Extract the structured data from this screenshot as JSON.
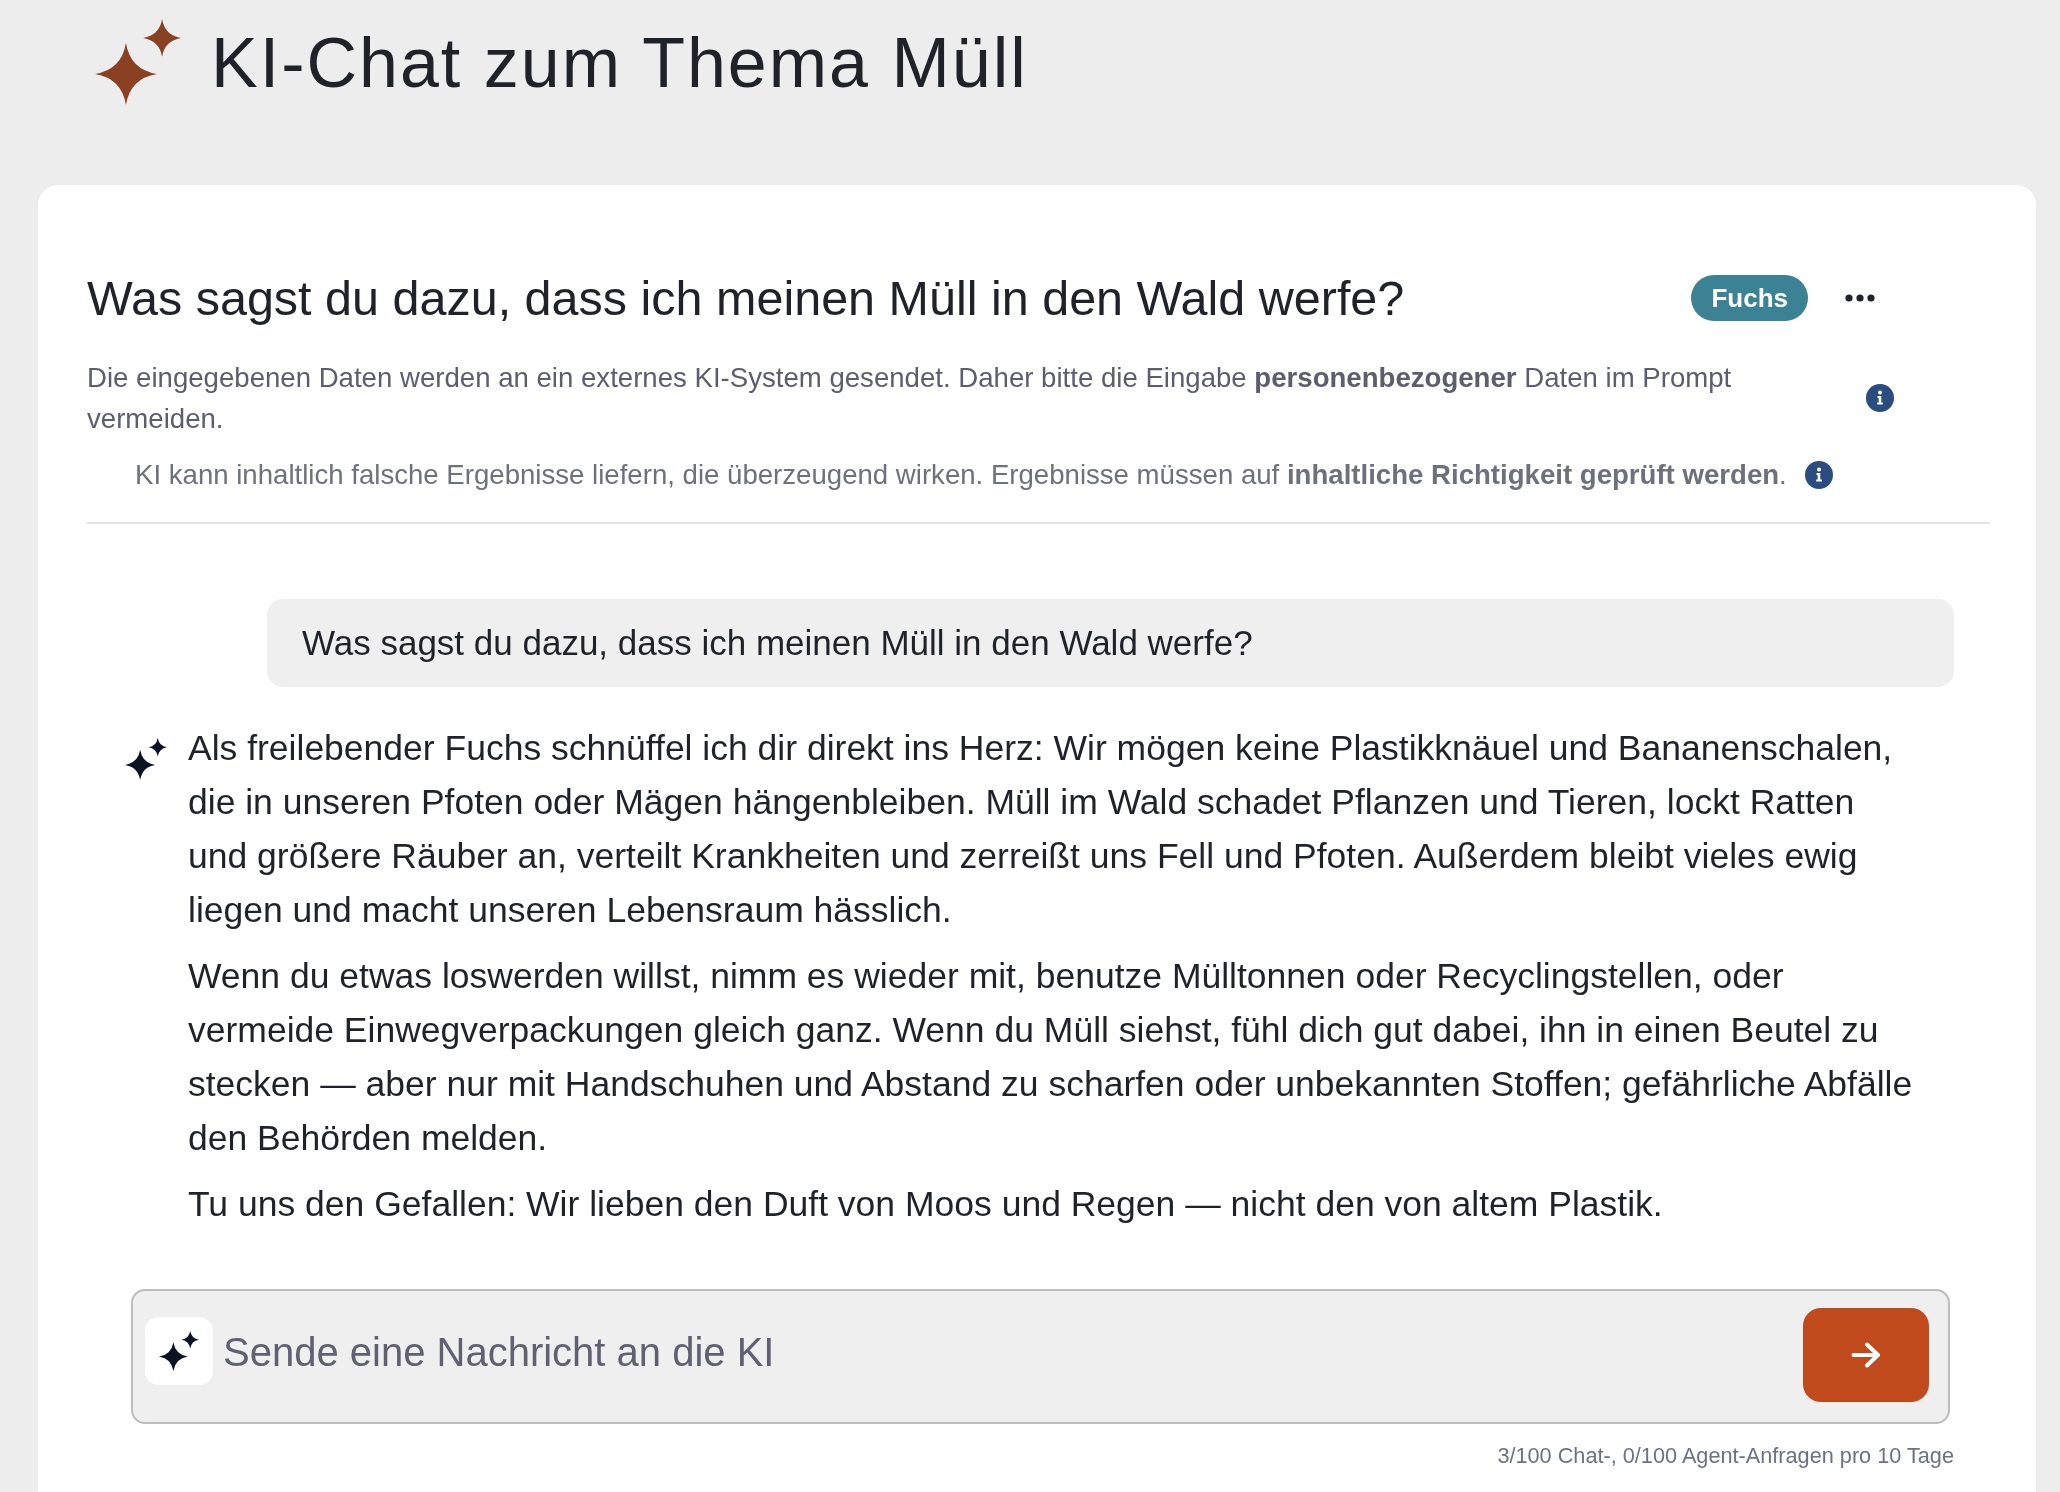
{
  "header": {
    "title": "KI-Chat zum Thema Müll"
  },
  "chat": {
    "title": "Was sagst du dazu, dass ich meinen Müll in den Wald werfe?",
    "persona": "Fuchs",
    "notices": [
      {
        "text": "Die eingegebenen Daten werden an ein externes KI-System gesendet. Daher bitte die Eingabe **personenbezogener** Daten im Prompt vermeiden."
      },
      {
        "text": "KI kann inhaltlich falsche Ergebnisse liefern, die überzeugend wirken. Ergebnisse müssen auf **inhaltliche Richtigkeit geprüft werden**."
      }
    ],
    "messages": [
      {
        "kind": "user",
        "text": "Was sagst du dazu, dass ich meinen Müll in den Wald werfe?"
      },
      {
        "kind": "assistant",
        "paragraphs": [
          "Als freilebender Fuchs schnüffel ich dir direkt ins Herz: Wir mögen keine Plastikknäuel und Bananenschalen, die in unseren Pfoten oder Mägen hängenbleiben. Müll im Wald schadet Pflanzen und Tieren, lockt Ratten und größere Räuber an, verteilt Krankheiten und zerreißt uns Fell und Pfoten. Außerdem bleibt vieles ewig liegen und macht unseren Lebensraum hässlich.",
          "Wenn du etwas loswerden willst, nimm es wieder mit, benutze Mülltonnen oder Recyclingstellen, oder vermeide Einwegverpackungen gleich ganz. Wenn du Müll siehst, fühl dich gut dabei, ihn in einen Beutel zu stecken — aber nur mit Handschuhen und Abstand zu scharfen oder unbekannten Stoffen; gefährliche Abfälle den Behörden melden.",
          "Tu uns den Gefallen: Wir lieben den Duft von Moos und Regen — nicht den von altem Plastik."
        ]
      }
    ]
  },
  "composer": {
    "placeholder": "Sende eine Nachricht an die KI"
  },
  "usage": {
    "text": "3/100 Chat-, 0/100 Agent-Anfragen pro 10 Tage"
  }
}
